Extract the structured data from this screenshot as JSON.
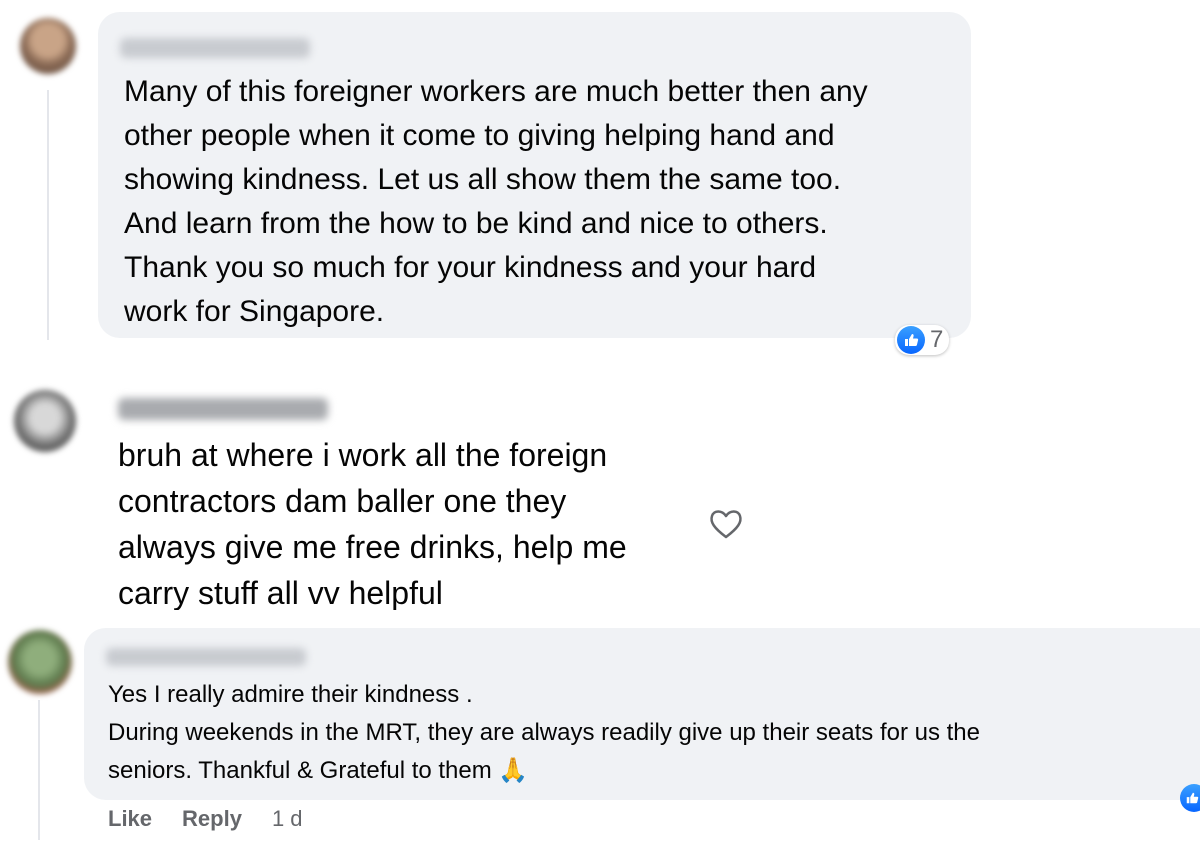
{
  "comments": [
    {
      "author_name": "",
      "text": "Many of this foreigner workers are much better then any\nother people when it come to giving helping hand and\nshowing kindness. Let us all show them the same too.\nAnd learn from the how to be kind and nice to others.\nThank you so much for your kindness and your hard\nwork for Singapore.",
      "reaction_count": "7"
    },
    {
      "author_name": "",
      "text": "bruh at where i work all the foreign\ncontractors dam baller one they\nalways give me free drinks, help me\ncarry stuff all vv helpful"
    },
    {
      "author_name": "",
      "text": "Yes I really admire their kindness .\nDuring weekends in the MRT, they are always readily give up their seats for us the\nseniors. Thankful & Grateful to them 🙏",
      "actions": {
        "like": "Like",
        "reply": "Reply",
        "time": "1 d"
      }
    }
  ],
  "icons": {
    "like": "thumbs-up-icon",
    "react": "heart-outline-icon"
  },
  "colors": {
    "bubble": "#f0f2f5",
    "like_blue": "#0866ff",
    "muted": "#65676b"
  }
}
